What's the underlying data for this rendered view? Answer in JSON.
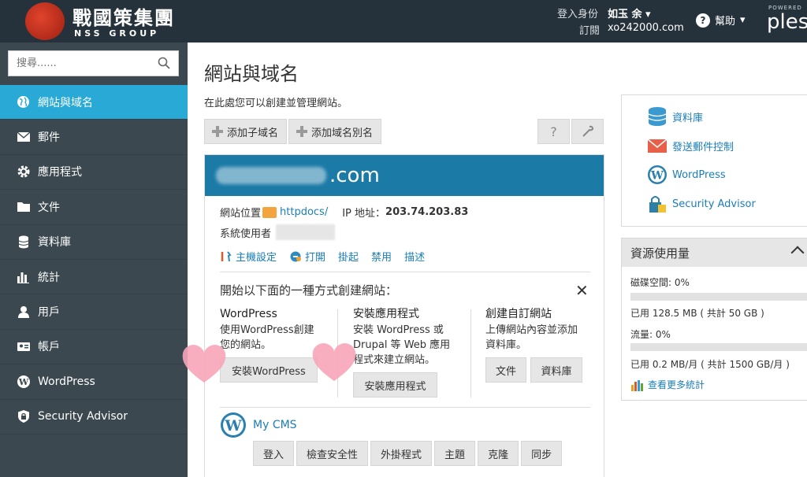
{
  "header": {
    "logo_text": "戰國策集團",
    "logo_sub": "NSS GROUP",
    "login_label": "登入身份",
    "user_name": "如玉 余",
    "subscription_label": "訂閱",
    "subscription_domain": "xo242000.com",
    "help_label": "幫助",
    "powered_label": "POWERED",
    "brand": "ples"
  },
  "sidebar": {
    "search_placeholder": "搜尋......",
    "items": [
      {
        "label": "網站與域名",
        "icon": "globe-icon",
        "active": true
      },
      {
        "label": "郵件",
        "icon": "mail-icon"
      },
      {
        "label": "應用程式",
        "icon": "gear-icon"
      },
      {
        "label": "文件",
        "icon": "folder-icon"
      },
      {
        "label": "資料庫",
        "icon": "database-icon"
      },
      {
        "label": "統計",
        "icon": "bar-chart-icon"
      },
      {
        "label": "用戶",
        "icon": "user-icon"
      },
      {
        "label": "帳戶",
        "icon": "account-icon"
      },
      {
        "label": "WordPress",
        "icon": "wordpress-icon"
      },
      {
        "label": "Security Advisor",
        "icon": "shield-lock-icon"
      }
    ]
  },
  "main": {
    "title": "網站與域名",
    "description": "在此處您可以創建並管理網站。",
    "toolbar": {
      "add_subdomain": "添加子域名",
      "add_alias": "添加域名別名",
      "help_symbol": "?"
    },
    "domain": {
      "name_suffix": ".com",
      "location_label": "網站位置",
      "location_path": "httpdocs/",
      "ip_label": "IP 地址：",
      "ip": "203.74.203.83",
      "system_user_label": "系統使用者",
      "actions": [
        "主機設定",
        "打開",
        "掛起",
        "禁用",
        "描述"
      ]
    },
    "start": {
      "title": "開始以下面的一種方式創建網站：",
      "close": "✕",
      "wordpress": {
        "title": "WordPress",
        "desc_line1": "使用WordPress創建",
        "desc_line2": "您的網站。",
        "button": "安裝WordPress"
      },
      "apps": {
        "title": "安裝應用程式",
        "desc_line1": "安裝 WordPress 或",
        "desc_line2": "Drupal 等 Web 應用",
        "desc_line3": "程式來建立網站。",
        "button": "安裝應用程式"
      },
      "custom": {
        "title": "創建自訂網站",
        "desc_line1": "上傳網站內容並添加",
        "desc_line2": "資料庫。",
        "btn_files": "文件",
        "btn_db": "資料庫"
      }
    },
    "cms": {
      "name": "My CMS",
      "buttons": [
        "登入",
        "檢查安全性",
        "外掛程式",
        "主題",
        "克隆",
        "同步"
      ]
    }
  },
  "right": {
    "links": [
      {
        "label": "資料庫",
        "icon": "database-icon"
      },
      {
        "label": "發送郵件控制",
        "icon": "mail-icon"
      },
      {
        "label": "WordPress",
        "icon": "wordpress-icon"
      },
      {
        "label": "Security Advisor",
        "icon": "shield-lock-icon"
      }
    ],
    "usage": {
      "title": "資源使用量",
      "disk_label": "磁碟空間: 0%",
      "disk_fraction": 0.0,
      "disk_used": "已用 128.5 MB ( 共計 50 GB )",
      "traffic_label": "流量: 0%",
      "traffic_fraction": 0.0,
      "traffic_used": "已用 0.2 MB/月 ( 共計 1500 GB/月 )",
      "more_stats": "查看更多統計"
    }
  },
  "colors": {
    "header_bg": "#26323b",
    "sidebar_bg": "#3b4850",
    "active": "#28a9d6",
    "card_head": "#1c7aa7",
    "link": "#1b7eb8"
  }
}
